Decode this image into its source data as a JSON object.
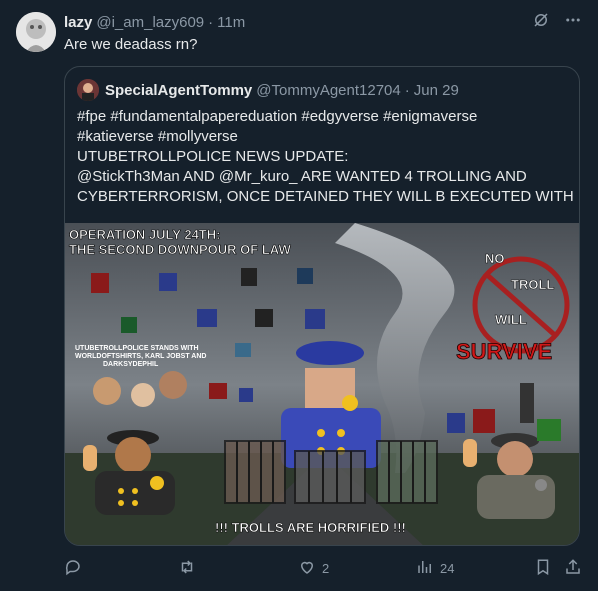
{
  "tweet": {
    "display_name": "lazy",
    "handle": "@i_am_lazy609",
    "separator": "·",
    "time": "11m",
    "text": "Are we deadass rn?"
  },
  "quote": {
    "display_name": "SpecialAgentTommy",
    "handle": "@TommyAgent12704",
    "separator": "·",
    "date": "Jun 29",
    "lines": [
      "#fpe #fundamentalpapereduation #edgyverse #enigmaverse",
      "#katieverse #mollyverse",
      "UTUBETROLLPOLICE NEWS UPDATE:",
      "@StickTh3Man AND @Mr_kuro_ ARE WANTED 4 TROLLING AND",
      "CYBERTERRORISM, ONCE DETAINED THEY WILL B EXECUTED WITH ..."
    ],
    "image": {
      "title_line1": "OPERATION JULY 24TH:",
      "title_line2": "THE SECOND DOWNPOUR OF LAW",
      "sign_word1": "NO",
      "sign_word2": "TROLL",
      "sign_word3": "WILL",
      "survive": "SURVIVE",
      "caption_line1": "UTUBETROLLPOLICE STANDS WITH",
      "caption_line2": "WORLDOFTSHIRTS, KARL JOBST AND",
      "caption_line3": "DARKSYDEPHIL",
      "bottom": "!!! TROLLS ARE HORRIFIED !!!"
    }
  },
  "actions": {
    "reply_count": "",
    "retweet_count": "",
    "like_count": "2",
    "views_count": "24"
  },
  "icons": {
    "grok": "grok-icon",
    "more": "more-icon",
    "reply": "reply-icon",
    "retweet": "retweet-icon",
    "like": "heart-icon",
    "views": "views-icon",
    "bookmark": "bookmark-icon",
    "share": "share-icon"
  },
  "colors": {
    "background": "#15202b",
    "text": "#e7e9ea",
    "muted": "#8b98a5",
    "border": "#38444d",
    "survive_red": "#d01818"
  }
}
